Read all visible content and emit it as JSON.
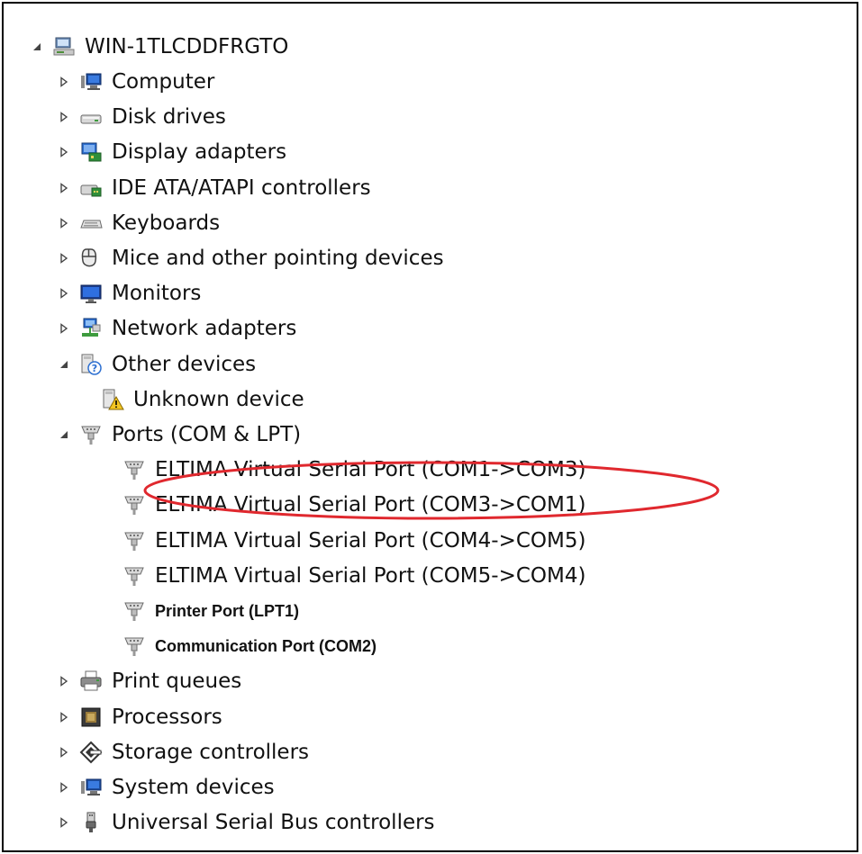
{
  "tree": {
    "root": {
      "label": "WIN-1TLCDDFRGTO",
      "expanded": true
    },
    "items": [
      {
        "label": "Computer",
        "icon": "computer-icon",
        "expander": "collapsed"
      },
      {
        "label": "Disk drives",
        "icon": "disk-drive-icon",
        "expander": "collapsed"
      },
      {
        "label": "Display adapters",
        "icon": "display-adapter-icon",
        "expander": "collapsed"
      },
      {
        "label": "IDE ATA/ATAPI controllers",
        "icon": "ide-controller-icon",
        "expander": "collapsed"
      },
      {
        "label": "Keyboards",
        "icon": "keyboard-icon",
        "expander": "collapsed"
      },
      {
        "label": "Mice and other pointing devices",
        "icon": "mouse-icon",
        "expander": "collapsed"
      },
      {
        "label": "Monitors",
        "icon": "monitor-icon",
        "expander": "collapsed"
      },
      {
        "label": "Network adapters",
        "icon": "network-adapter-icon",
        "expander": "collapsed"
      },
      {
        "label": "Other devices",
        "icon": "other-devices-icon",
        "expander": "expanded"
      },
      {
        "label": "Unknown device",
        "icon": "unknown-device-icon",
        "expander": "none"
      },
      {
        "label": "Ports (COM & LPT)",
        "icon": "port-icon",
        "expander": "expanded"
      },
      {
        "label": "ELTIMA Virtual Serial Port (COM1->COM3)",
        "icon": "port-icon",
        "expander": "none"
      },
      {
        "label": "ELTIMA Virtual Serial Port (COM3->COM1)",
        "icon": "port-icon",
        "expander": "none"
      },
      {
        "label": "ELTIMA Virtual Serial Port (COM4->COM5)",
        "icon": "port-icon",
        "expander": "none"
      },
      {
        "label": "ELTIMA Virtual Serial Port (COM5->COM4)",
        "icon": "port-icon",
        "expander": "none"
      },
      {
        "label": "Printer Port (LPT1)",
        "icon": "port-icon",
        "expander": "none",
        "bold": true
      },
      {
        "label": "Communication Port (COM2)",
        "icon": "port-icon",
        "expander": "none",
        "bold": true
      },
      {
        "label": "Print queues",
        "icon": "printer-icon",
        "expander": "collapsed"
      },
      {
        "label": "Processors",
        "icon": "processor-icon",
        "expander": "collapsed"
      },
      {
        "label": "Storage controllers",
        "icon": "storage-controller-icon",
        "expander": "collapsed"
      },
      {
        "label": "System devices",
        "icon": "system-devices-icon",
        "expander": "collapsed"
      },
      {
        "label": "Universal Serial Bus controllers",
        "icon": "usb-controller-icon",
        "expander": "collapsed"
      }
    ]
  },
  "annotation": {
    "shape": "ellipse",
    "color": "#e0282e"
  }
}
